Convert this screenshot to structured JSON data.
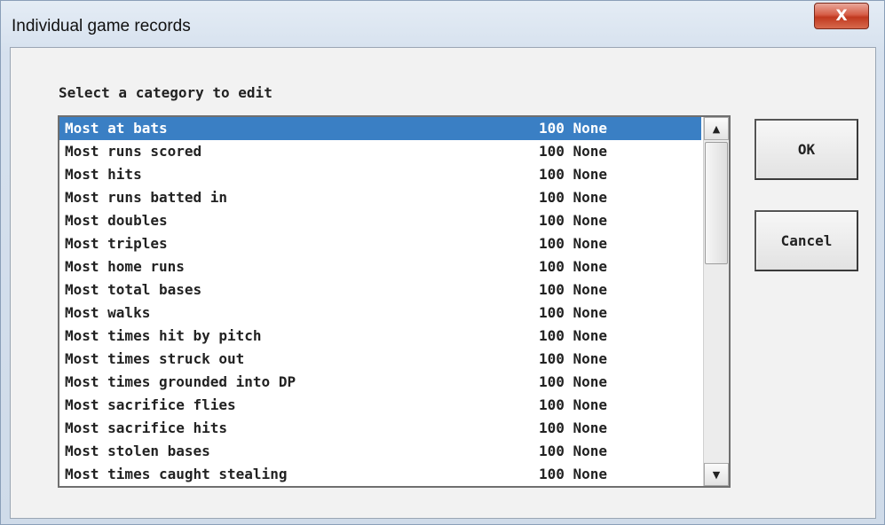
{
  "window": {
    "title": "Individual game records",
    "close_glyph": "X"
  },
  "prompt": "Select a category to edit",
  "list": {
    "selected_index": 0,
    "items": [
      {
        "name": "Most at bats",
        "value": "100 None"
      },
      {
        "name": "Most runs scored",
        "value": "100 None"
      },
      {
        "name": "Most hits",
        "value": "100 None"
      },
      {
        "name": "Most runs batted in",
        "value": "100 None"
      },
      {
        "name": "Most doubles",
        "value": "100 None"
      },
      {
        "name": "Most triples",
        "value": "100 None"
      },
      {
        "name": "Most home runs",
        "value": "100 None"
      },
      {
        "name": "Most total bases",
        "value": "100 None"
      },
      {
        "name": "Most walks",
        "value": "100 None"
      },
      {
        "name": "Most times hit by pitch",
        "value": "100 None"
      },
      {
        "name": "Most times struck out",
        "value": "100 None"
      },
      {
        "name": "Most times grounded into DP",
        "value": "100 None"
      },
      {
        "name": "Most sacrifice flies",
        "value": "100 None"
      },
      {
        "name": "Most sacrifice hits",
        "value": "100 None"
      },
      {
        "name": "Most stolen bases",
        "value": "100 None"
      },
      {
        "name": "Most times caught stealing",
        "value": "100 None"
      }
    ]
  },
  "scrollbar": {
    "up_icon": "scroll-up-arrow-icon",
    "down_icon": "scroll-down-arrow-icon",
    "up_glyph": "▲",
    "down_glyph": "▼"
  },
  "buttons": {
    "ok_label": "OK",
    "cancel_label": "Cancel"
  },
  "colors": {
    "selection": "#3a7fc4",
    "close_button": "#c0391f"
  }
}
